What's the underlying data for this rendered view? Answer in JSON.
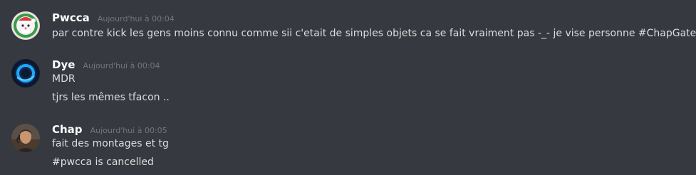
{
  "messages": [
    {
      "username": "Pwcca",
      "timestamp": "Aujourd'hui à 00:04",
      "avatar": "santa-face-avatar",
      "lines": [
        "par contre kick les gens moins connu comme sii c'etait de simples objets ca se fait vraiment pas -_- je vise personne #ChapGate"
      ]
    },
    {
      "username": "Dye",
      "timestamp": "Aujourd'hui à 00:04",
      "avatar": "blue-ring-avatar",
      "lines": [
        "MDR",
        "tjrs les mêmes tfacon .."
      ]
    },
    {
      "username": "Chap",
      "timestamp": "Aujourd'hui à 00:05",
      "avatar": "person-photo-avatar",
      "lines": [
        "fait des montages et tg",
        "#pwcca is cancelled"
      ]
    }
  ],
  "colors": {
    "background": "#36393f",
    "username": "#ffffff",
    "timestamp": "#72767d",
    "text": "#dcddde"
  }
}
